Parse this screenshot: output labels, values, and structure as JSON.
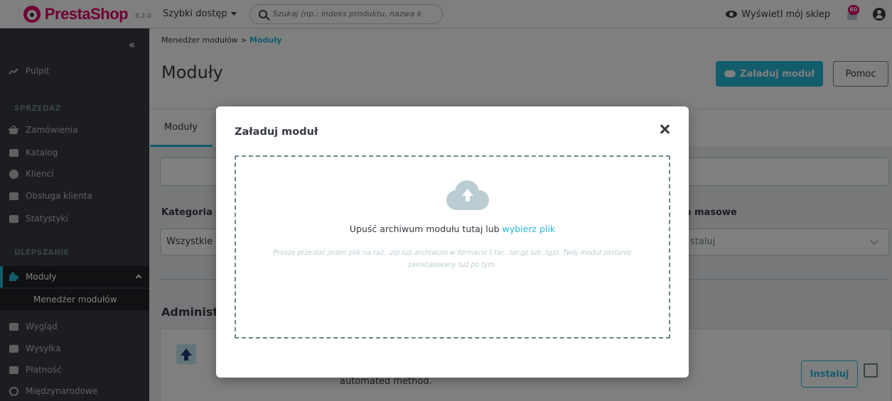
{
  "header": {
    "logo_text": "PrestaShop",
    "version": "8.2.0",
    "quick_access": "Szybki dostęp",
    "search_placeholder": "Szukaj (np.: indeks produktu, nazwa k",
    "view_shop": "Wyświetl mój sklep",
    "notifications_count": "60"
  },
  "sidebar": {
    "dashboard": "Pulpit",
    "section_sales": "SPRZEDAŻ",
    "orders": "Zamówienia",
    "catalog": "Katalog",
    "customers": "Klienci",
    "customer_service": "Obsługa klienta",
    "stats": "Statystyki",
    "section_improve": "ULEPSZANIE",
    "modules": "Moduły",
    "module_manager": "Menedżer modułów",
    "design": "Wygląd",
    "shipping": "Wysyłka",
    "payment": "Płatność",
    "international": "Międzynarodowe"
  },
  "page": {
    "breadcrumb_parent": "Menedżer modułów",
    "breadcrumb_sep": ">",
    "breadcrumb_current": "Moduły",
    "title": "Moduły",
    "upload_button": "Załaduj moduł",
    "help_button": "Pomoc",
    "tab_modules": "Moduły",
    "label_category": "Kategoria",
    "category_value": "Wszystkie k",
    "label_bulk": "nia masowe",
    "bulk_value": "staluj",
    "admin_heading": "Administ",
    "card_text": "automated method.",
    "install_button": "Instaluj"
  },
  "modal": {
    "title": "Załaduj moduł",
    "drop_text": "Upuść archiwum modułu tutaj lub",
    "drop_link": "wybierz plik",
    "hint": "Proszę przesłać jeden plik na raz, .zip lub archiwum w formacie (.tar, .tar.gz lub .tgz). Twój moduł zostanie zainstalowany tuż po tym."
  },
  "colors": {
    "primary": "#25b9d7",
    "brand": "#df0067",
    "sidebar_bg": "#363a41"
  }
}
